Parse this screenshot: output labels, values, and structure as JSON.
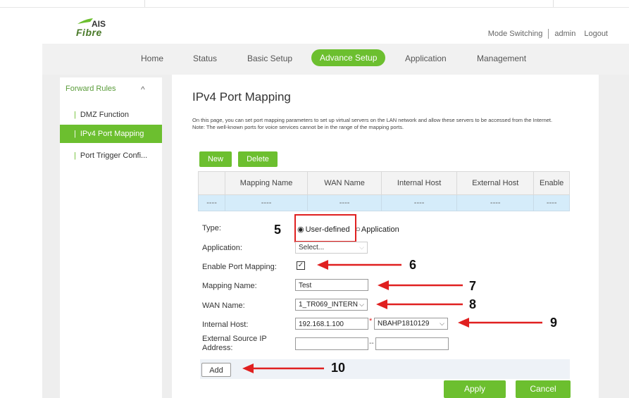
{
  "header": {
    "logo_text_top": "AIS",
    "logo_text_bottom": "Fibre",
    "mode_switching": "Mode Switching",
    "user": "admin",
    "logout": "Logout"
  },
  "nav": {
    "items": [
      "Home",
      "Status",
      "Basic Setup",
      "Advance Setup",
      "Application",
      "Management"
    ],
    "active": "Advance Setup"
  },
  "sidebar": {
    "section": "Forward Rules",
    "items": [
      "DMZ Function",
      "IPv4 Port Mapping",
      "Port Trigger Confi..."
    ],
    "active": "IPv4 Port Mapping"
  },
  "page": {
    "title": "IPv4 Port Mapping",
    "desc1": "On this page, you can set port mapping parameters to set up virtual servers on the LAN network and allow these servers to be accessed from the Internet.",
    "desc2": "Note: The well-known ports for voice services cannot be in the range of the mapping ports."
  },
  "buttons": {
    "new": "New",
    "delete": "Delete",
    "add": "Add",
    "apply": "Apply",
    "cancel": "Cancel"
  },
  "table": {
    "headers": [
      "",
      "Mapping Name",
      "WAN Name",
      "Internal Host",
      "External Host",
      "Enable"
    ],
    "row": [
      "----",
      "----",
      "----",
      "----",
      "----",
      "----"
    ]
  },
  "form": {
    "type_label": "Type:",
    "type_options": [
      "User-defined",
      "Application"
    ],
    "type_selected": "User-defined",
    "application_label": "Application:",
    "application_value": "Select...",
    "enable_label": "Enable Port Mapping:",
    "enable_checked": true,
    "mapping_name_label": "Mapping Name:",
    "mapping_name_value": "Test",
    "wan_name_label": "WAN Name:",
    "wan_name_value": "1_TR069_INTERN",
    "internal_host_label": "Internal Host:",
    "internal_host_value": "192.168.1.100",
    "required_mark": "*",
    "host_device_value": "NBAHP1810129",
    "ext_src_label_1": "External Source IP",
    "ext_src_label_2": "Address:",
    "range_sep": "--"
  },
  "annotations": {
    "labels": [
      "5",
      "6",
      "7",
      "8",
      "9",
      "10"
    ],
    "color": "#e02020"
  },
  "colors": {
    "accent": "#6cbf2f",
    "table_row": "#d5ecfa"
  }
}
